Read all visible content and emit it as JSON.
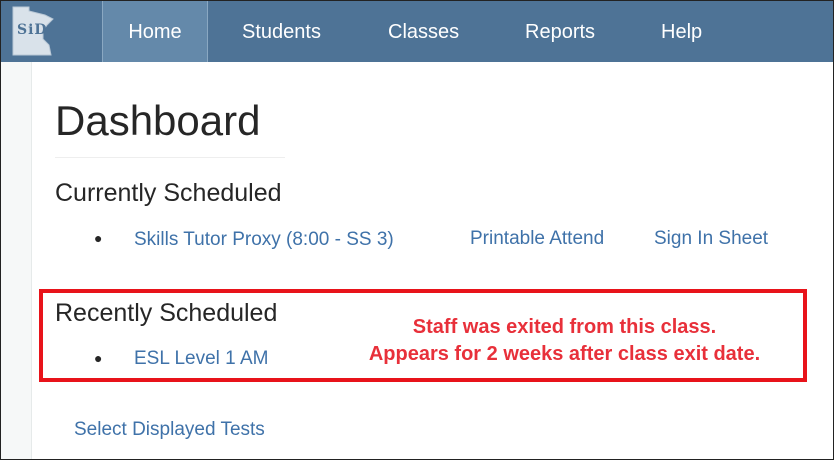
{
  "brand": {
    "logo_text": "SiD"
  },
  "nav": {
    "items": [
      {
        "label": "Home"
      },
      {
        "label": "Students"
      },
      {
        "label": "Classes"
      },
      {
        "label": "Reports"
      },
      {
        "label": "Help"
      }
    ],
    "active": "Home"
  },
  "page": {
    "title": "Dashboard"
  },
  "currently_scheduled": {
    "heading": "Currently Scheduled",
    "class_link": "Skills Tutor Proxy (8:00 - SS 3)",
    "printable_attend": "Printable Attend",
    "sign_in_sheet": "Sign In Sheet"
  },
  "recently_scheduled": {
    "heading": "Recently Scheduled",
    "class_link": "ESL Level 1 AM"
  },
  "annotation": {
    "line1": "Staff was exited from this class.",
    "line2": "Appears for 2 weeks after class exit date.",
    "color": "#e8131a"
  },
  "footer_links": {
    "select_displayed_tests": "Select Displayed Tests"
  },
  "colors": {
    "navbar": "#4e7396",
    "nav_active": "#6489aa",
    "link": "#3f72a9",
    "text": "#262626"
  }
}
